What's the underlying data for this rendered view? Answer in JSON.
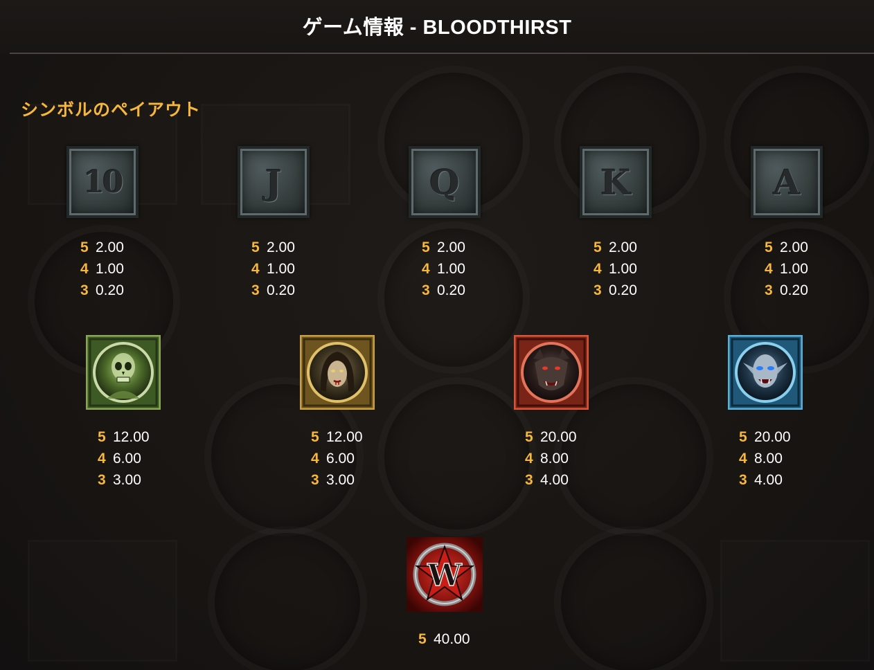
{
  "header": {
    "title": "ゲーム情報 - BLOODTHIRST"
  },
  "section": {
    "title": "シンボルのペイアウト"
  },
  "symbols_low": [
    {
      "icon": "stone-10-icon",
      "letter": "10",
      "payouts": [
        {
          "count": "5",
          "value": "2.00"
        },
        {
          "count": "4",
          "value": "1.00"
        },
        {
          "count": "3",
          "value": "0.20"
        }
      ]
    },
    {
      "icon": "stone-j-icon",
      "letter": "J",
      "payouts": [
        {
          "count": "5",
          "value": "2.00"
        },
        {
          "count": "4",
          "value": "1.00"
        },
        {
          "count": "3",
          "value": "0.20"
        }
      ]
    },
    {
      "icon": "stone-q-icon",
      "letter": "Q",
      "payouts": [
        {
          "count": "5",
          "value": "2.00"
        },
        {
          "count": "4",
          "value": "1.00"
        },
        {
          "count": "3",
          "value": "0.20"
        }
      ]
    },
    {
      "icon": "stone-k-icon",
      "letter": "K",
      "payouts": [
        {
          "count": "5",
          "value": "2.00"
        },
        {
          "count": "4",
          "value": "1.00"
        },
        {
          "count": "3",
          "value": "0.20"
        }
      ]
    },
    {
      "icon": "stone-a-icon",
      "letter": "A",
      "payouts": [
        {
          "count": "5",
          "value": "2.00"
        },
        {
          "count": "4",
          "value": "1.00"
        },
        {
          "count": "3",
          "value": "0.20"
        }
      ]
    }
  ],
  "symbols_high": [
    {
      "icon": "skeleton-icon",
      "frame_color": "#6f8a3c",
      "payouts": [
        {
          "count": "5",
          "value": "12.00"
        },
        {
          "count": "4",
          "value": "6.00"
        },
        {
          "count": "3",
          "value": "3.00"
        }
      ]
    },
    {
      "icon": "vampire-woman-icon",
      "frame_color": "#b38a2e",
      "payouts": [
        {
          "count": "5",
          "value": "12.00"
        },
        {
          "count": "4",
          "value": "6.00"
        },
        {
          "count": "3",
          "value": "3.00"
        }
      ]
    },
    {
      "icon": "werewolf-icon",
      "frame_color": "#b33a2a",
      "payouts": [
        {
          "count": "5",
          "value": "20.00"
        },
        {
          "count": "4",
          "value": "8.00"
        },
        {
          "count": "3",
          "value": "4.00"
        }
      ]
    },
    {
      "icon": "vampire-icon",
      "frame_color": "#3a8fb8",
      "payouts": [
        {
          "count": "5",
          "value": "20.00"
        },
        {
          "count": "4",
          "value": "8.00"
        },
        {
          "count": "3",
          "value": "4.00"
        }
      ]
    }
  ],
  "symbol_wild": {
    "icon": "wild-w-icon",
    "letter": "W",
    "frame_color": "#c0241c",
    "payouts": [
      {
        "count": "5",
        "value": "40.00"
      }
    ]
  },
  "colors": {
    "accent": "#f6b73c",
    "text": "#ffffff",
    "background": "#191614"
  }
}
